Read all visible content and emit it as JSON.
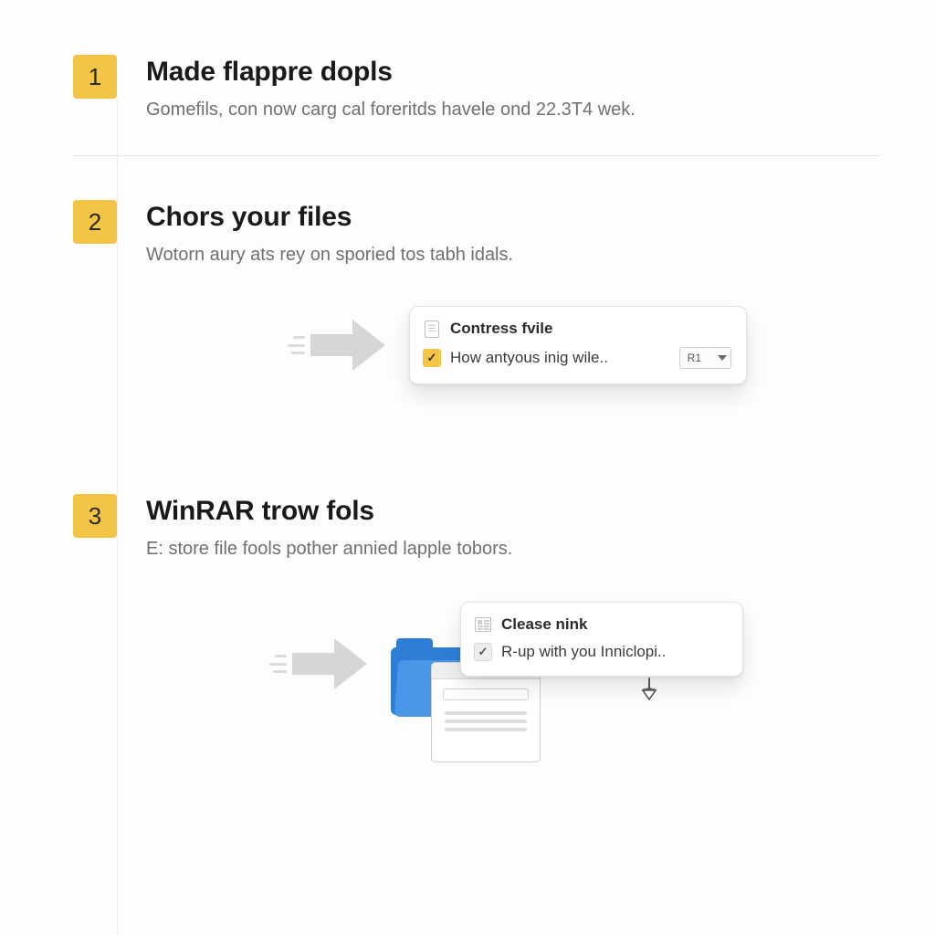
{
  "steps": [
    {
      "num": "1",
      "title": "Made flappre dopls",
      "desc": "Gomefils, con now carg cal foreritds havele ond 22.3T4 wek."
    },
    {
      "num": "2",
      "title": "Chors your files",
      "desc": "Wotorn aury ats rey on sporied tos tabh idals."
    },
    {
      "num": "3",
      "title": "WinRAR trow fols",
      "desc": "E: store file fools pother annied lapple tobors."
    }
  ],
  "popup2": {
    "row1": "Contress fvile",
    "row2": "How antyous inig wile..",
    "select": "R1"
  },
  "popup3": {
    "row1": "Clease nink",
    "row2": "R-up with you Inniclopi.."
  }
}
